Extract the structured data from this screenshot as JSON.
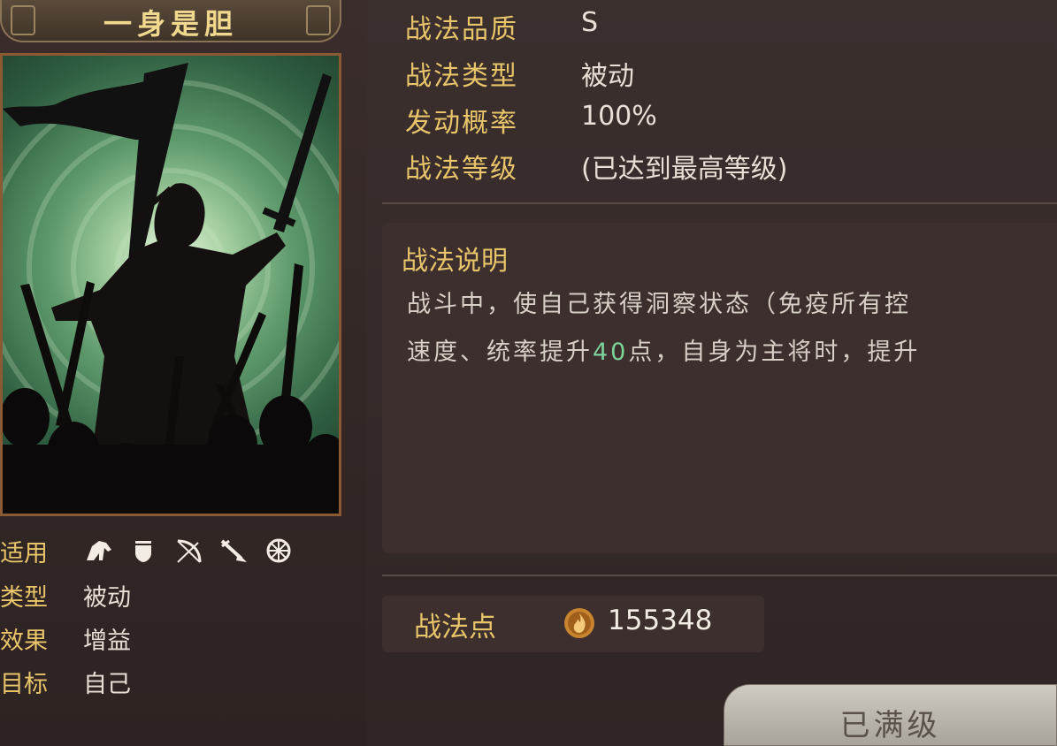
{
  "skill": {
    "name": "一身是胆"
  },
  "left_info": {
    "rows": [
      {
        "label": "适用",
        "icons": [
          "cavalry-icon",
          "shield-icon",
          "bow-icon",
          "spear-icon",
          "chariot-icon"
        ]
      },
      {
        "label": "类型",
        "value": "被动"
      },
      {
        "label": "效果",
        "value": "增益"
      },
      {
        "label": "目标",
        "value": "自己"
      }
    ]
  },
  "attributes": [
    {
      "label": "战法品质",
      "value": "S"
    },
    {
      "label": "战法类型",
      "value": "被动"
    },
    {
      "label": "发动概率",
      "value": "100%"
    },
    {
      "label": "战法等级",
      "value": "(已达到最高等级)"
    }
  ],
  "description": {
    "title": "战法说明",
    "line1": "战斗中，使自己获得洞察状态（免疫所有控",
    "line2_prefix": "速度、统率提升",
    "line2_highlight": "40",
    "line2_suffix": "点，自身为主将时，提升"
  },
  "points": {
    "label": "战法点",
    "icon": "flame-coin-icon",
    "value": "155348"
  },
  "button": {
    "label": "已满级"
  },
  "colors": {
    "label_gold": "#e8c56a",
    "highlight_green": "#7ed39a",
    "frame_brown": "#8b5a33"
  }
}
